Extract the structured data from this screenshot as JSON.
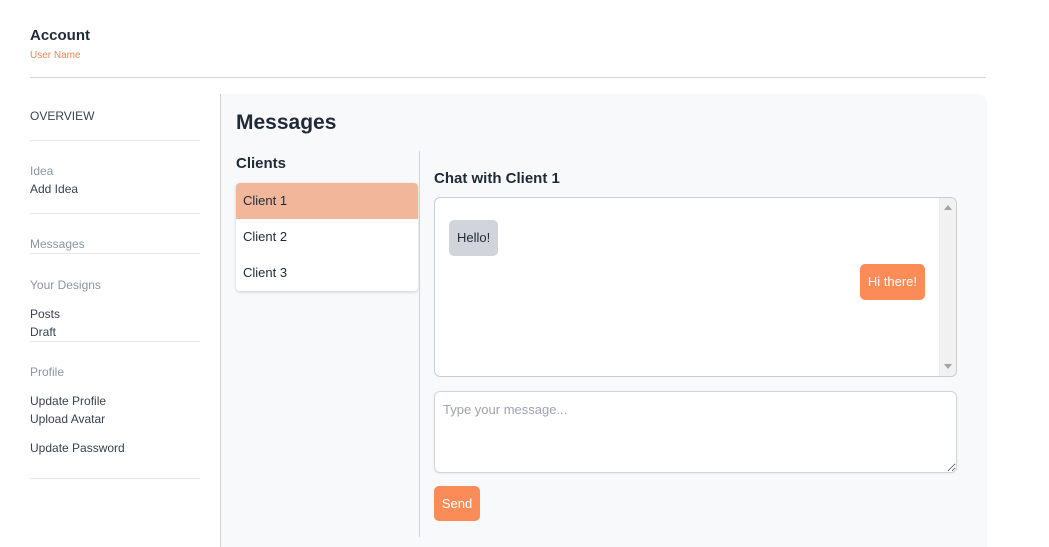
{
  "header": {
    "title": "Account",
    "subtitle": "User Name"
  },
  "sidebar": {
    "overview": "OVERVIEW",
    "idea_section": "Idea",
    "add_idea": "Add Idea",
    "messages": "Messages",
    "designs_section": "Your Designs",
    "posts": "Posts",
    "draft": "Draft",
    "profile_section": "Profile",
    "update_profile": "Update Profile",
    "upload_avatar": "Upload Avatar",
    "update_password": "Update Password"
  },
  "main": {
    "heading": "Messages",
    "clients_title": "Clients",
    "clients": [
      {
        "name": "Client 1"
      },
      {
        "name": "Client 2"
      },
      {
        "name": "Client 3"
      }
    ],
    "chat_title": "Chat with Client 1",
    "messages": [
      {
        "text": "Hello!"
      },
      {
        "text": "Hi there!"
      }
    ],
    "input_placeholder": "Type your message...",
    "input_value": "",
    "send_label": "Send"
  },
  "colors": {
    "accent": "#fb8c58",
    "active_client": "#f2b79b",
    "subtitle": "#e0895a"
  }
}
